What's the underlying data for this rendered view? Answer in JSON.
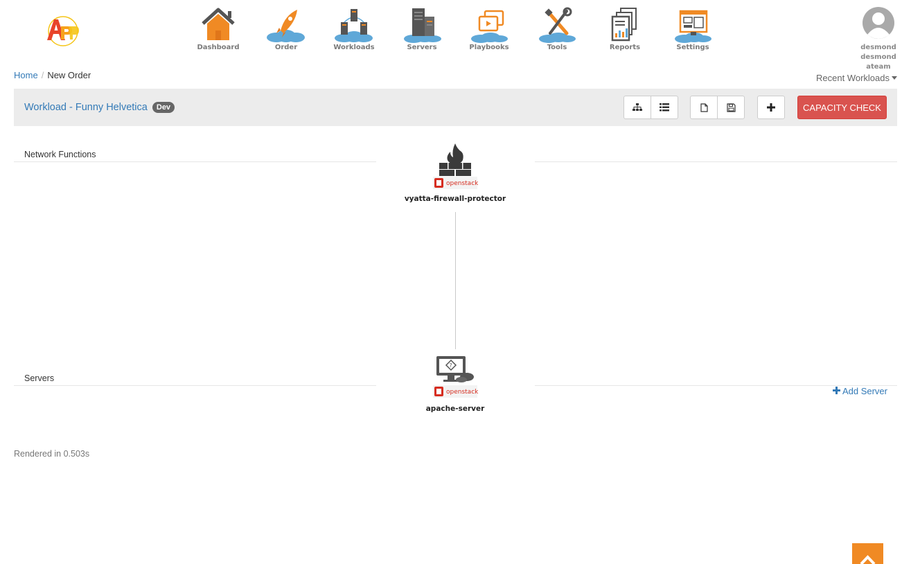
{
  "nav": {
    "items": [
      {
        "label": "Dashboard",
        "icon": "house-icon"
      },
      {
        "label": "Order",
        "icon": "rocket-icon"
      },
      {
        "label": "Workloads",
        "icon": "workloads-icon"
      },
      {
        "label": "Servers",
        "icon": "servers-icon"
      },
      {
        "label": "Playbooks",
        "icon": "playbooks-icon"
      },
      {
        "label": "Tools",
        "icon": "tools-icon"
      },
      {
        "label": "Reports",
        "icon": "reports-icon"
      },
      {
        "label": "Settings",
        "icon": "settings-icon"
      }
    ],
    "user": {
      "line1": "desmond desmond",
      "line2": "ateam"
    }
  },
  "breadcrumb": {
    "home": "Home",
    "separator": "/",
    "current": "New Order"
  },
  "recent_workloads": "Recent Workloads",
  "workload": {
    "title": "Workload - Funny Helvetica",
    "badge": "Dev",
    "capacity_check": "CAPACITY CHECK"
  },
  "sections": {
    "network_functions": "Network Functions",
    "servers": "Servers"
  },
  "nodes": {
    "firewall": {
      "label": "vyatta-firewall-protector",
      "platform": "openstack"
    },
    "server": {
      "label": "apache-server",
      "platform": "openstack"
    }
  },
  "add_server": "Add Server",
  "rendered": "Rendered in 0.503s",
  "colors": {
    "accent": "#337ab7",
    "danger": "#d9534f",
    "orange": "#f08a24",
    "cloud": "#5fa8d8"
  }
}
